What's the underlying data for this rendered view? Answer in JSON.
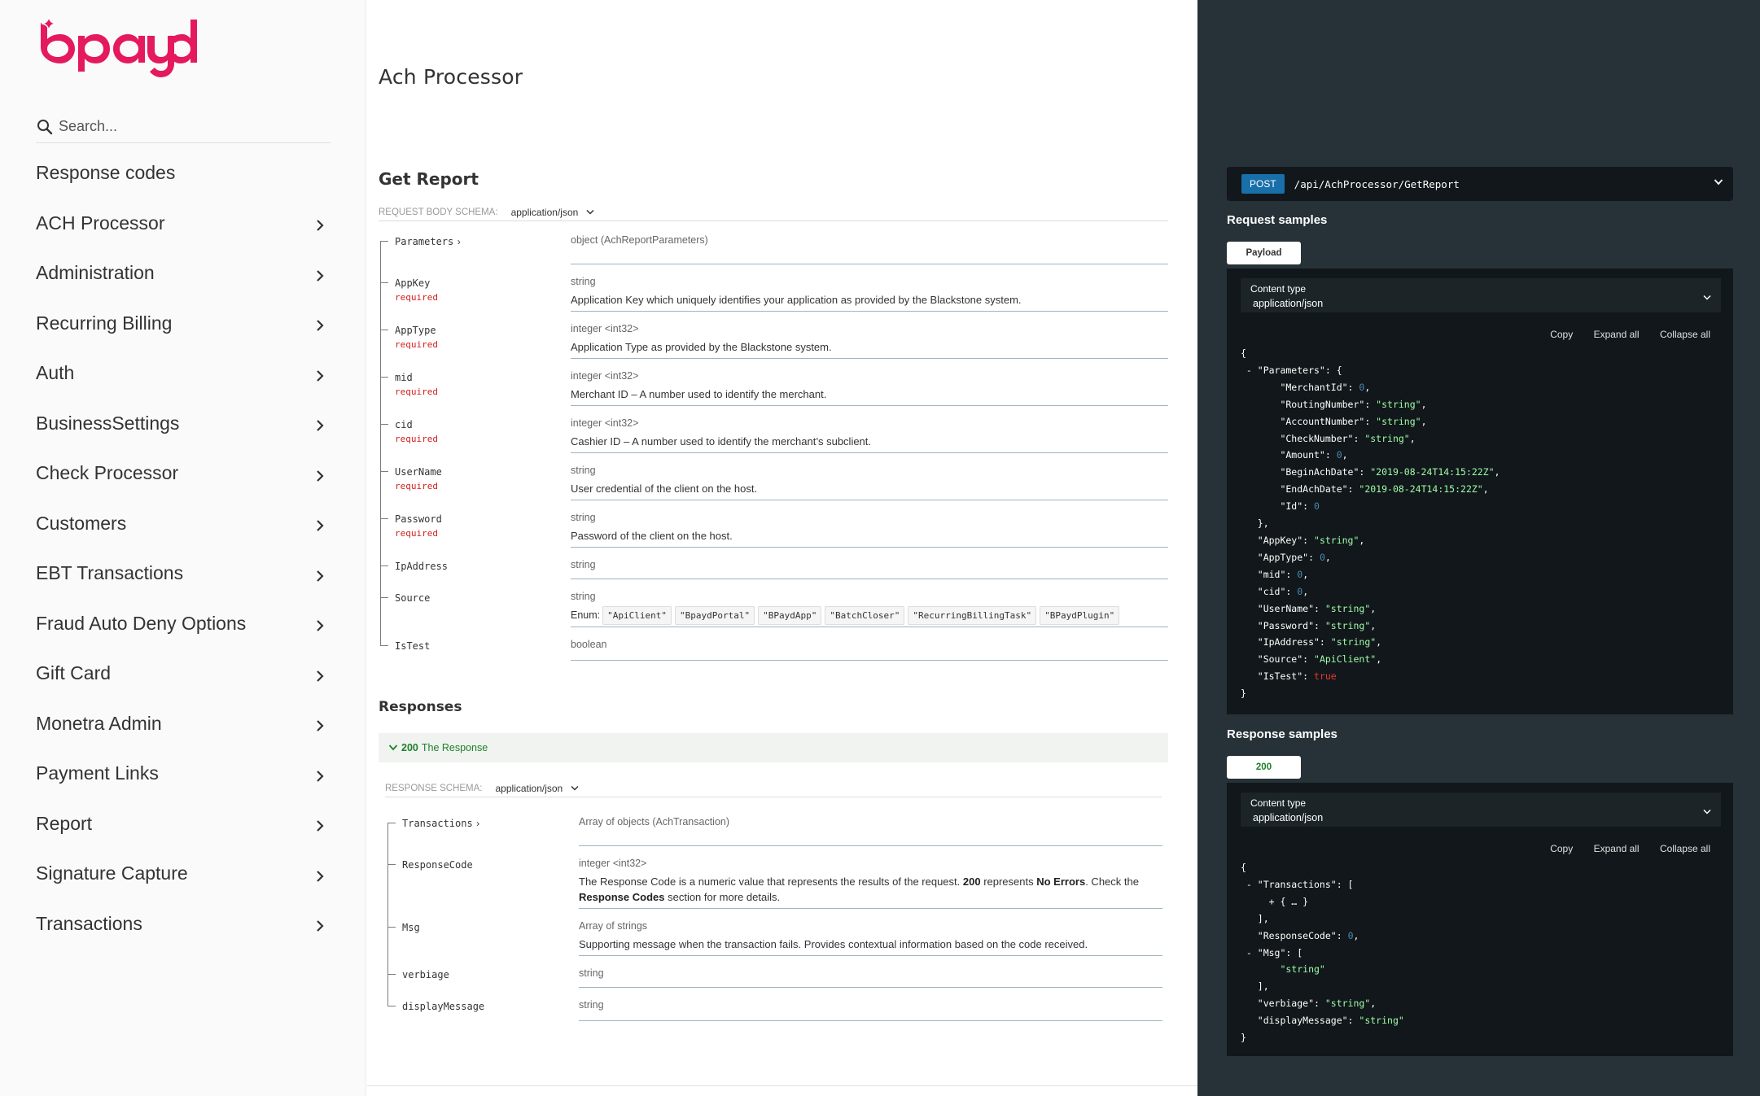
{
  "sidebar": {
    "logo_text": "bpayd",
    "search_placeholder": "Search...",
    "items": [
      {
        "label": "Response codes",
        "chevron": false
      },
      {
        "label": "ACH Processor",
        "chevron": true
      },
      {
        "label": "Administration",
        "chevron": true
      },
      {
        "label": "Recurring Billing",
        "chevron": true
      },
      {
        "label": "Auth",
        "chevron": true
      },
      {
        "label": "BusinessSettings",
        "chevron": true
      },
      {
        "label": "Check Processor",
        "chevron": true
      },
      {
        "label": "Customers",
        "chevron": true
      },
      {
        "label": "EBT Transactions",
        "chevron": true
      },
      {
        "label": "Fraud Auto Deny Options",
        "chevron": true
      },
      {
        "label": "Gift Card",
        "chevron": true
      },
      {
        "label": "Monetra Admin",
        "chevron": true
      },
      {
        "label": "Payment Links",
        "chevron": true
      },
      {
        "label": "Report",
        "chevron": true
      },
      {
        "label": "Signature Capture",
        "chevron": true
      },
      {
        "label": "Transactions",
        "chevron": true
      }
    ]
  },
  "content": {
    "section_title": "Ach Processor",
    "op_title": "Get Report",
    "request_schema_label": "REQUEST BODY SCHEMA:",
    "request_content_type": "application/json",
    "request_params": [
      {
        "name": "Parameters",
        "expandable": true,
        "required": false,
        "type": "object (AchReportParameters)",
        "desc": ""
      },
      {
        "name": "AppKey",
        "required": true,
        "type": "string",
        "desc": "Application Key which uniquely identifies your application as provided by the Blackstone system."
      },
      {
        "name": "AppType",
        "required": true,
        "type": "integer <int32>",
        "desc": "Application Type as provided by the Blackstone system."
      },
      {
        "name": "mid",
        "required": true,
        "type": "integer <int32>",
        "desc": "Merchant ID – A number used to identify the merchant."
      },
      {
        "name": "cid",
        "required": true,
        "type": "integer <int32>",
        "desc": "Cashier ID – A number used to identify the merchant’s subclient."
      },
      {
        "name": "UserName",
        "required": true,
        "type": "string",
        "desc": "User credential of the client on the host."
      },
      {
        "name": "Password",
        "required": true,
        "type": "string",
        "desc": "Password of the client on the host."
      },
      {
        "name": "IpAddress",
        "required": false,
        "type": "string",
        "desc": ""
      },
      {
        "name": "Source",
        "required": false,
        "type": "string",
        "desc": "",
        "enum_label": "Enum:",
        "enum": [
          "\"ApiClient\"",
          "\"BpaydPortal\"",
          "\"BPaydApp\"",
          "\"BatchCloser\"",
          "\"RecurringBillingTask\"",
          "\"BPaydPlugin\""
        ]
      },
      {
        "name": "IsTest",
        "required": false,
        "type": "boolean",
        "desc": ""
      }
    ],
    "required_label": "required",
    "responses_title": "Responses",
    "response_code": "200",
    "response_text": "The Response",
    "response_schema_label": "RESPONSE SCHEMA:",
    "response_content_type": "application/json",
    "response_params": [
      {
        "name": "Transactions",
        "expandable": true,
        "type": "Array of objects (AchTransaction)",
        "desc": ""
      },
      {
        "name": "ResponseCode",
        "type": "integer <int32>",
        "desc_parts": [
          "The Response Code is a numeric value that represents the results of the request. ",
          "200",
          " represents ",
          "No Errors",
          ". Check the ",
          "Response Codes",
          " section for more details."
        ]
      },
      {
        "name": "Msg",
        "type": "Array of strings",
        "desc": "Supporting message when the transaction fails. Provides contextual information based on the code received."
      },
      {
        "name": "verbiage",
        "type": "string",
        "desc": ""
      },
      {
        "name": "displayMessage",
        "type": "string",
        "desc": ""
      }
    ]
  },
  "right": {
    "method": "POST",
    "path": "/api/AchProcessor/GetReport",
    "request_samples_title": "Request samples",
    "request_tab": "Payload",
    "content_type_label": "Content type",
    "content_type_value": "application/json",
    "copy": "Copy",
    "expand_all": "Expand all",
    "collapse_all": "Collapse all",
    "request_code": [
      [
        [
          "p",
          "{"
        ]
      ],
      [
        [
          "p",
          " - \"Parameters\": {"
        ]
      ],
      [
        [
          "p",
          "       \"MerchantId\": "
        ],
        [
          "n",
          "0"
        ],
        [
          "p",
          ","
        ]
      ],
      [
        [
          "p",
          "       \"RoutingNumber\": "
        ],
        [
          "s",
          "\"string\""
        ],
        [
          "p",
          ","
        ]
      ],
      [
        [
          "p",
          "       \"AccountNumber\": "
        ],
        [
          "s",
          "\"string\""
        ],
        [
          "p",
          ","
        ]
      ],
      [
        [
          "p",
          "       \"CheckNumber\": "
        ],
        [
          "s",
          "\"string\""
        ],
        [
          "p",
          ","
        ]
      ],
      [
        [
          "p",
          "       \"Amount\": "
        ],
        [
          "n",
          "0"
        ],
        [
          "p",
          ","
        ]
      ],
      [
        [
          "p",
          "       \"BeginAchDate\": "
        ],
        [
          "s",
          "\"2019-08-24T14:15:22Z\""
        ],
        [
          "p",
          ","
        ]
      ],
      [
        [
          "p",
          "       \"EndAchDate\": "
        ],
        [
          "s",
          "\"2019-08-24T14:15:22Z\""
        ],
        [
          "p",
          ","
        ]
      ],
      [
        [
          "p",
          "       \"Id\": "
        ],
        [
          "n",
          "0"
        ]
      ],
      [
        [
          "p",
          "   },"
        ]
      ],
      [
        [
          "p",
          "   \"AppKey\": "
        ],
        [
          "s",
          "\"string\""
        ],
        [
          "p",
          ","
        ]
      ],
      [
        [
          "p",
          "   \"AppType\": "
        ],
        [
          "n",
          "0"
        ],
        [
          "p",
          ","
        ]
      ],
      [
        [
          "p",
          "   \"mid\": "
        ],
        [
          "n",
          "0"
        ],
        [
          "p",
          ","
        ]
      ],
      [
        [
          "p",
          "   \"cid\": "
        ],
        [
          "n",
          "0"
        ],
        [
          "p",
          ","
        ]
      ],
      [
        [
          "p",
          "   \"UserName\": "
        ],
        [
          "s",
          "\"string\""
        ],
        [
          "p",
          ","
        ]
      ],
      [
        [
          "p",
          "   \"Password\": "
        ],
        [
          "s",
          "\"string\""
        ],
        [
          "p",
          ","
        ]
      ],
      [
        [
          "p",
          "   \"IpAddress\": "
        ],
        [
          "s",
          "\"string\""
        ],
        [
          "p",
          ","
        ]
      ],
      [
        [
          "p",
          "   \"Source\": "
        ],
        [
          "s",
          "\"ApiClient\""
        ],
        [
          "p",
          ","
        ]
      ],
      [
        [
          "p",
          "   \"IsTest\": "
        ],
        [
          "b",
          "true"
        ]
      ],
      [
        [
          "p",
          "}"
        ]
      ]
    ],
    "response_samples_title": "Response samples",
    "response_tab": "200",
    "response_code": [
      [
        [
          "p",
          "{"
        ]
      ],
      [
        [
          "p",
          " - \"Transactions\": ["
        ]
      ],
      [
        [
          "p",
          "     + { … }"
        ]
      ],
      [
        [
          "p",
          "   ],"
        ]
      ],
      [
        [
          "p",
          "   \"ResponseCode\": "
        ],
        [
          "n",
          "0"
        ],
        [
          "p",
          ","
        ]
      ],
      [
        [
          "p",
          " - \"Msg\": ["
        ]
      ],
      [
        [
          "p",
          "       "
        ],
        [
          "s",
          "\"string\""
        ]
      ],
      [
        [
          "p",
          "   ],"
        ]
      ],
      [
        [
          "p",
          "   \"verbiage\": "
        ],
        [
          "s",
          "\"string\""
        ],
        [
          "p",
          ","
        ]
      ],
      [
        [
          "p",
          "   \"displayMessage\": "
        ],
        [
          "s",
          "\"string\""
        ]
      ],
      [
        [
          "p",
          "}"
        ]
      ]
    ]
  },
  "colors": {
    "brand": "#e5195e",
    "method_post": "#186fa9",
    "required": "#d41f1c",
    "success": "#1d8127",
    "right_panel_bg": "#263238",
    "code_bg": "#11171a"
  }
}
